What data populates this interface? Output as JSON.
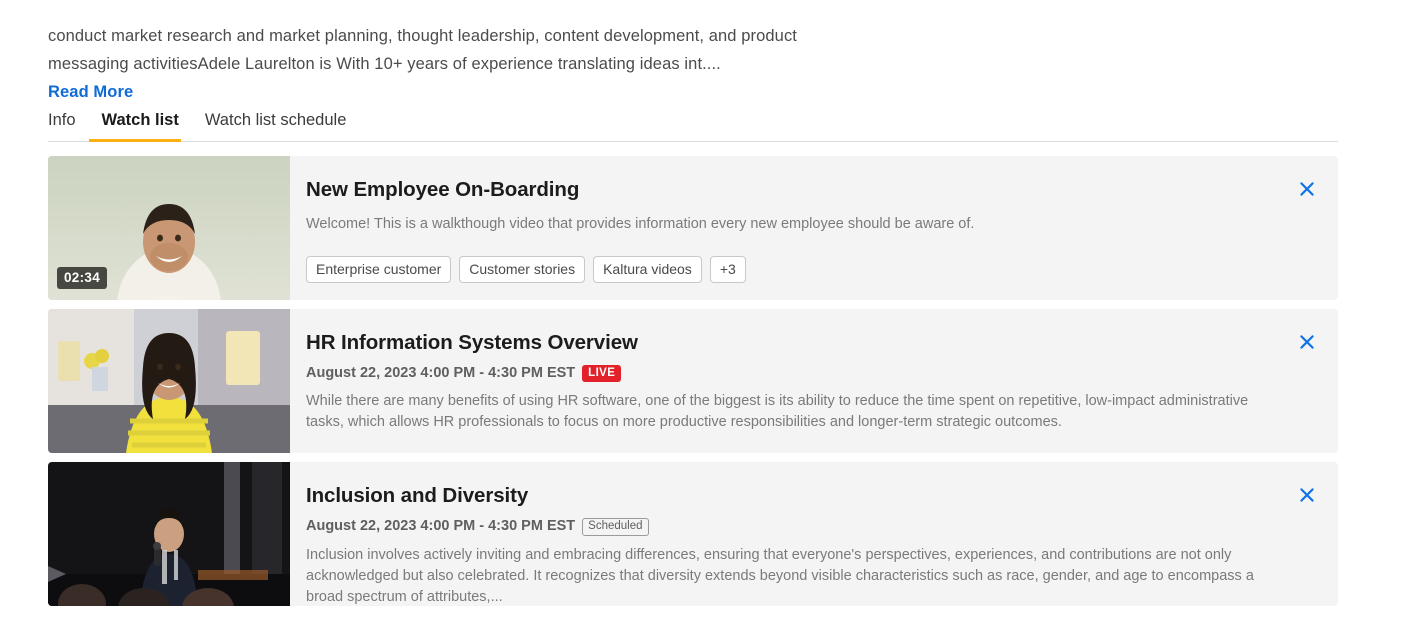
{
  "bio": {
    "text": "conduct market research and market planning, thought leadership, content development, and product messaging activitiesAdele Laurelton is With 10+ years of experience translating ideas int....",
    "read_more_label": "Read More"
  },
  "tabs": [
    {
      "label": "Info",
      "active": false
    },
    {
      "label": "Watch list",
      "active": true
    },
    {
      "label": "Watch list schedule",
      "active": false
    }
  ],
  "accent_colors": {
    "tab_underline": "#fdb014",
    "link": "#0f6cd6",
    "close_icon": "#0f72e6",
    "live_badge": "#e2212a",
    "card_background": "#f4f4f4"
  },
  "cards": [
    {
      "title": "New Employee On-Boarding",
      "duration": "02:34",
      "schedule": null,
      "status_badge": null,
      "description": "Welcome! This is a walkthough video that provides information every new employee should be aware of.",
      "tags": [
        "Enterprise customer",
        "Customer stories",
        "Kaltura videos",
        "+3"
      ],
      "close_label": "Remove from watch list"
    },
    {
      "title": "HR Information Systems Overview",
      "duration": null,
      "schedule": "August 22, 2023 4:00 PM - 4:30 PM EST",
      "status_badge": "LIVE",
      "status_badge_type": "live",
      "description": "While there are many benefits of using HR software, one of the biggest is its ability to reduce the time spent on repetitive, low-impact administrative tasks, which allows HR professionals to focus on more productive responsibilities and longer-term strategic outcomes.",
      "tags": [],
      "close_label": "Remove from watch list"
    },
    {
      "title": "Inclusion and Diversity",
      "duration": null,
      "schedule": "August 22, 2023 4:00 PM - 4:30 PM EST",
      "status_badge": "Scheduled",
      "status_badge_type": "scheduled",
      "description": "Inclusion involves actively inviting and embracing differences, ensuring that everyone's perspectives, experiences, and contributions are not only acknowledged but also celebrated. It recognizes that diversity extends beyond visible characteristics such as race, gender, and age to encompass a broad spectrum of attributes,...",
      "tags": [],
      "close_label": "Remove from watch list"
    }
  ]
}
